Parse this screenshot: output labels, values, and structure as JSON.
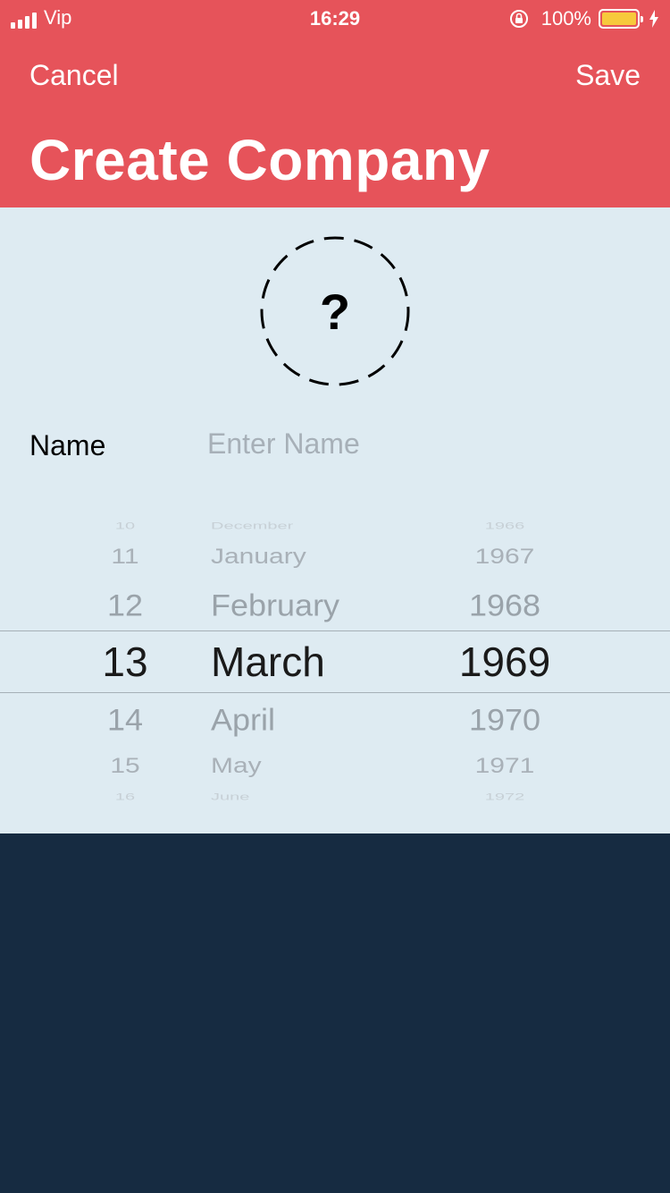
{
  "status_bar": {
    "carrier": "Vip",
    "time": "16:29",
    "battery_percent": "100%",
    "battery_color": "#f7c93c"
  },
  "nav": {
    "cancel_label": "Cancel",
    "save_label": "Save",
    "title": "Create Company"
  },
  "avatar": {
    "icon": "question-mark-icon",
    "glyph": "?"
  },
  "form": {
    "name_label": "Name",
    "name_value": "",
    "name_placeholder": "Enter Name"
  },
  "date_picker": {
    "selected": {
      "day": "13",
      "month": "March",
      "year": "1969"
    },
    "day_items": [
      "10",
      "11",
      "12",
      "13",
      "14",
      "15",
      "16"
    ],
    "month_items": [
      "December",
      "January",
      "February",
      "March",
      "April",
      "May",
      "June"
    ],
    "year_items": [
      "1966",
      "1967",
      "1968",
      "1969",
      "1970",
      "1971",
      "1972"
    ]
  },
  "colors": {
    "header_background": "#e6535a",
    "content_background": "#deebf2",
    "footer_background": "#162b41"
  }
}
